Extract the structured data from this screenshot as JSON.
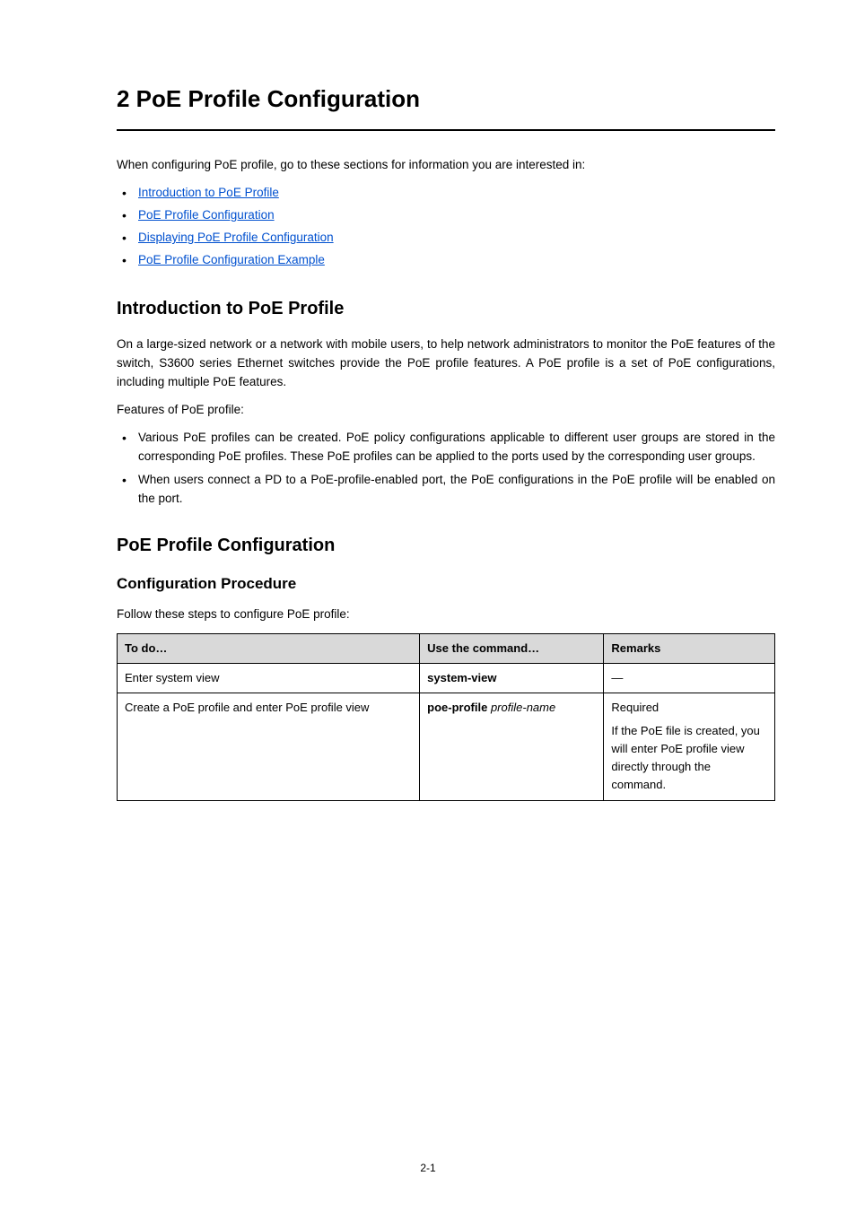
{
  "chapter": {
    "title": "2 PoE Profile Configuration"
  },
  "intro": "When configuring PoE profile, go to these sections for information you are interested in:",
  "toc_links": [
    "Introduction to PoE Profile",
    "PoE Profile Configuration",
    "Displaying PoE Profile Configuration",
    "PoE Profile Configuration Example"
  ],
  "sec_intro_h": "Introduction to PoE Profile",
  "sec_intro_body": "On a large-sized network or a network with mobile users, to help network administrators to monitor the PoE features of the switch, S3600 series Ethernet switches provide the PoE profile features. A PoE profile is a set of PoE configurations, including multiple PoE features.",
  "sec_intro_feat_lead": "Features of PoE profile:",
  "sec_intro_feat": [
    "Various PoE profiles can be created. PoE policy configurations applicable to different user groups are stored in the corresponding PoE profiles. These PoE profiles can be applied to the ports used by the corresponding user groups.",
    "When users connect a PD to a PoE-profile-enabled port, the PoE configurations in the PoE profile will be enabled on the port."
  ],
  "sec_cfg_h": "PoE Profile Configuration",
  "sec_cfg_sub_h": "Configuration Procedure",
  "sec_cfg_lead": "Follow these steps to configure PoE profile:",
  "table": {
    "headers": [
      "To do…",
      "Use the command…",
      "Remarks"
    ],
    "rows": [
      {
        "todo": "Enter system view",
        "cmd": "system-view",
        "rem": "—"
      },
      {
        "todo": "Create a PoE profile and enter PoE profile view",
        "cmd_prefix": "poe-profile ",
        "cmd_arg": "profile-name",
        "rem_head": "Required",
        "rem_body": "If the PoE file is created, you will enter PoE profile view directly through the command."
      }
    ]
  },
  "footer": "2-1"
}
